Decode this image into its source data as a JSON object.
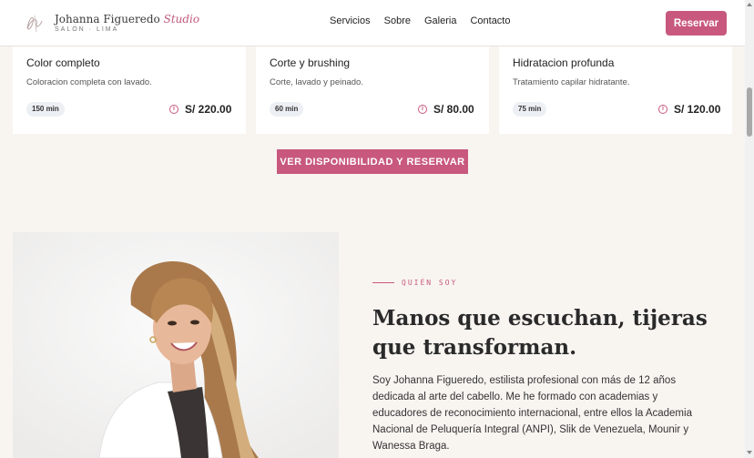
{
  "header": {
    "logo_name": "Johanna Figueredo",
    "logo_studio": "Studio",
    "logo_sub": "SALÓN · LIMA",
    "nav": [
      "Servicios",
      "Sobre",
      "Galeria",
      "Contacto"
    ],
    "cta_label": "Reservar"
  },
  "services": [
    {
      "title": "Color completo",
      "desc": "Coloracion completa con lavado.",
      "duration": "150 min",
      "price": "S/ 220.00"
    },
    {
      "title": "Corte y brushing",
      "desc": "Corte, lavado y peinado.",
      "duration": "60 min",
      "price": "S/ 80.00"
    },
    {
      "title": "Hidratacion profunda",
      "desc": "Tratamiento capilar hidratante.",
      "duration": "75 min",
      "price": "S/ 120.00"
    }
  ],
  "availability_button": "VER DISPONIBILIDAD Y RESERVAR",
  "about": {
    "eyebrow": "QUIÉN SOY",
    "title": "Manos que escuchan, tijeras que transforman.",
    "text": "Soy Johanna Figueredo, estilista profesional con más de 12 años dedicada al arte del cabello. Me he formado con academias y educadores de reconocimiento internacional, entre ellos la Academia Nacional de Peluquería Integral (ANPI), Slik de Venezuela, Mounir y Wanessa Braga."
  },
  "colors": {
    "accent": "#c8587e",
    "background": "#f8f5f1",
    "card": "#ffffff"
  },
  "icons": {
    "info": "info-circle-icon",
    "logo": "signature-logo-icon"
  }
}
